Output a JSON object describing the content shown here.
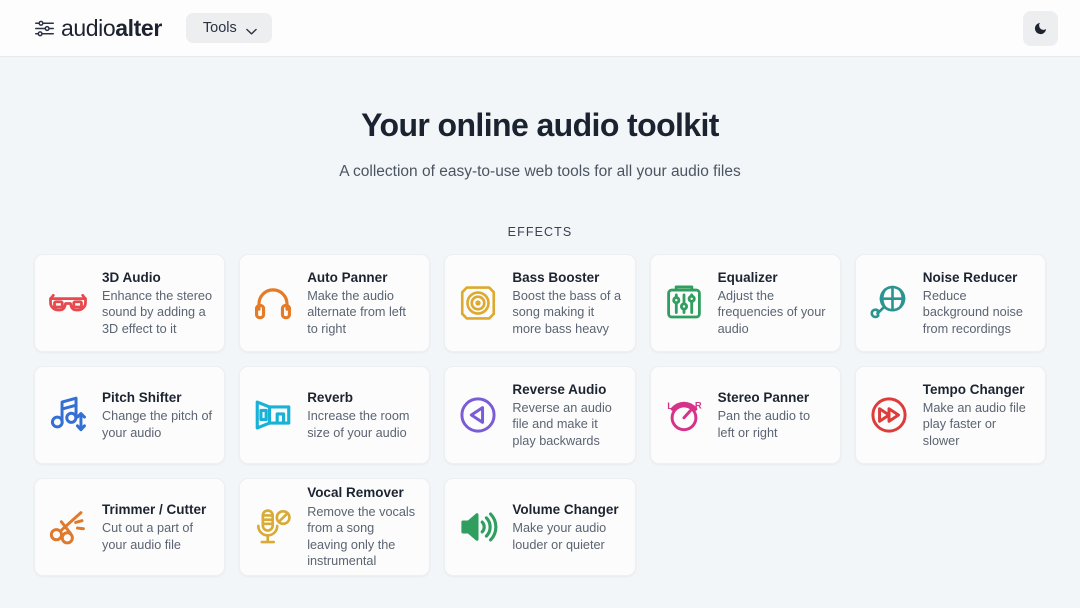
{
  "header": {
    "brand_light": "audio",
    "brand_bold": "alter",
    "brand_icon": "sliders-icon",
    "tools_label": "Tools",
    "tools_chevron_icon": "chevron-down-icon",
    "theme_toggle_icon": "moon-icon"
  },
  "hero": {
    "title": "Your online audio toolkit",
    "subtitle": "A collection of easy-to-use web tools for all your audio files"
  },
  "section": {
    "label": "EFFECTS"
  },
  "tools": [
    {
      "title": "3D Audio",
      "desc": "Enhance the stereo sound by adding a 3D effect to it",
      "icon": "glasses-3d-icon",
      "color": "#e8494f"
    },
    {
      "title": "Auto Panner",
      "desc": "Make the audio alternate from left to right",
      "icon": "headphones-icon",
      "color": "#e57a27"
    },
    {
      "title": "Bass Booster",
      "desc": "Boost the bass of a song making it more bass heavy",
      "icon": "speaker-bass-icon",
      "color": "#dda92f"
    },
    {
      "title": "Equalizer",
      "desc": "Adjust the frequencies of your audio",
      "icon": "equalizer-icon",
      "color": "#2f9e5f"
    },
    {
      "title": "Noise Reducer",
      "desc": "Reduce background noise from recordings",
      "icon": "mic-mesh-icon",
      "color": "#2a9490"
    },
    {
      "title": "Pitch Shifter",
      "desc": "Change the pitch of your audio",
      "icon": "pitch-note-icon",
      "color": "#3470d4"
    },
    {
      "title": "Reverb",
      "desc": "Increase the room size of your audio",
      "icon": "room-icon",
      "color": "#18b2d8"
    },
    {
      "title": "Reverse Audio",
      "desc": "Reverse an audio file and make it play backwards",
      "icon": "reverse-play-icon",
      "color": "#7a5cd6"
    },
    {
      "title": "Stereo Panner",
      "desc": "Pan the audio to left or right",
      "icon": "pan-knob-icon",
      "color": "#d5338a"
    },
    {
      "title": "Tempo Changer",
      "desc": "Make an audio file play faster or slower",
      "icon": "fast-forward-icon",
      "color": "#de3b3b"
    },
    {
      "title": "Trimmer / Cutter",
      "desc": "Cut out a part of your audio file",
      "icon": "scissors-icon",
      "color": "#e0792c"
    },
    {
      "title": "Vocal Remover",
      "desc": "Remove the vocals from a song leaving only the instrumental",
      "icon": "mic-blocked-icon",
      "color": "#d9ab36"
    },
    {
      "title": "Volume Changer",
      "desc": "Make your audio louder or quieter",
      "icon": "volume-icon",
      "color": "#2f9e5f"
    }
  ],
  "colors": {
    "page_bg": "#f2f6f8",
    "header_bg": "#fdfdfd",
    "card_bg": "#fcfcfc",
    "title_text": "#1b2230",
    "body_text": "#5b6472",
    "button_bg": "#eceef0"
  }
}
